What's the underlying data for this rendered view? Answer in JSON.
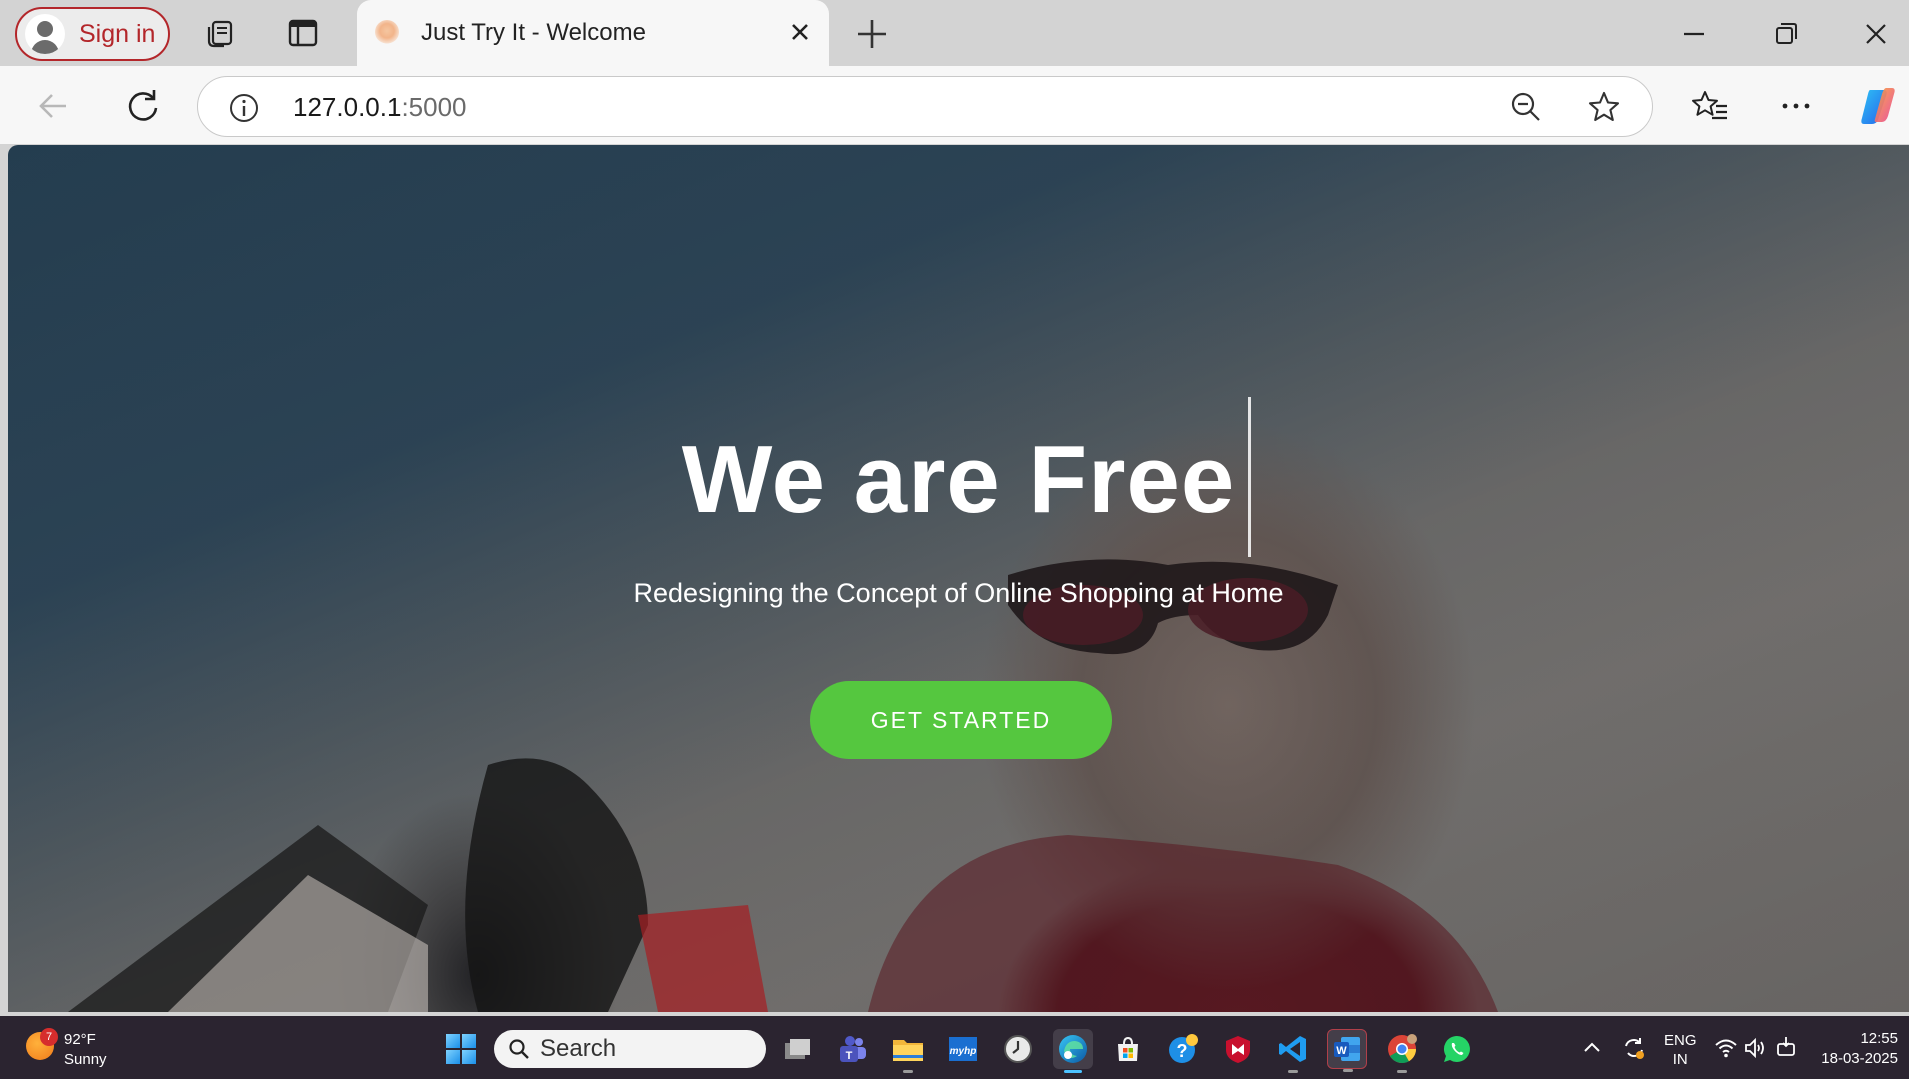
{
  "browser": {
    "sign_in_label": "Sign in",
    "active_tab_title": "Just Try It - Welcome",
    "url_host": "127.0.0.1",
    "url_port": ":5000"
  },
  "page": {
    "hero_title": "We are Free",
    "hero_subtitle": "Redesigning the Concept of Online Shopping at Home",
    "cta_label": "GET STARTED",
    "cta_color": "#55c73f"
  },
  "taskbar": {
    "weather_badge": "7",
    "weather_temp": "92°F",
    "weather_condition": "Sunny",
    "search_label": "Search",
    "apps": [
      "task-view",
      "teams",
      "file-explorer",
      "myhp",
      "clock-app",
      "edge",
      "microsoft-store",
      "help",
      "mcafee",
      "vscode",
      "word",
      "chrome",
      "whatsapp"
    ],
    "lang_top": "ENG",
    "lang_bottom": "IN",
    "time": "12:55",
    "date": "18-03-2025"
  }
}
